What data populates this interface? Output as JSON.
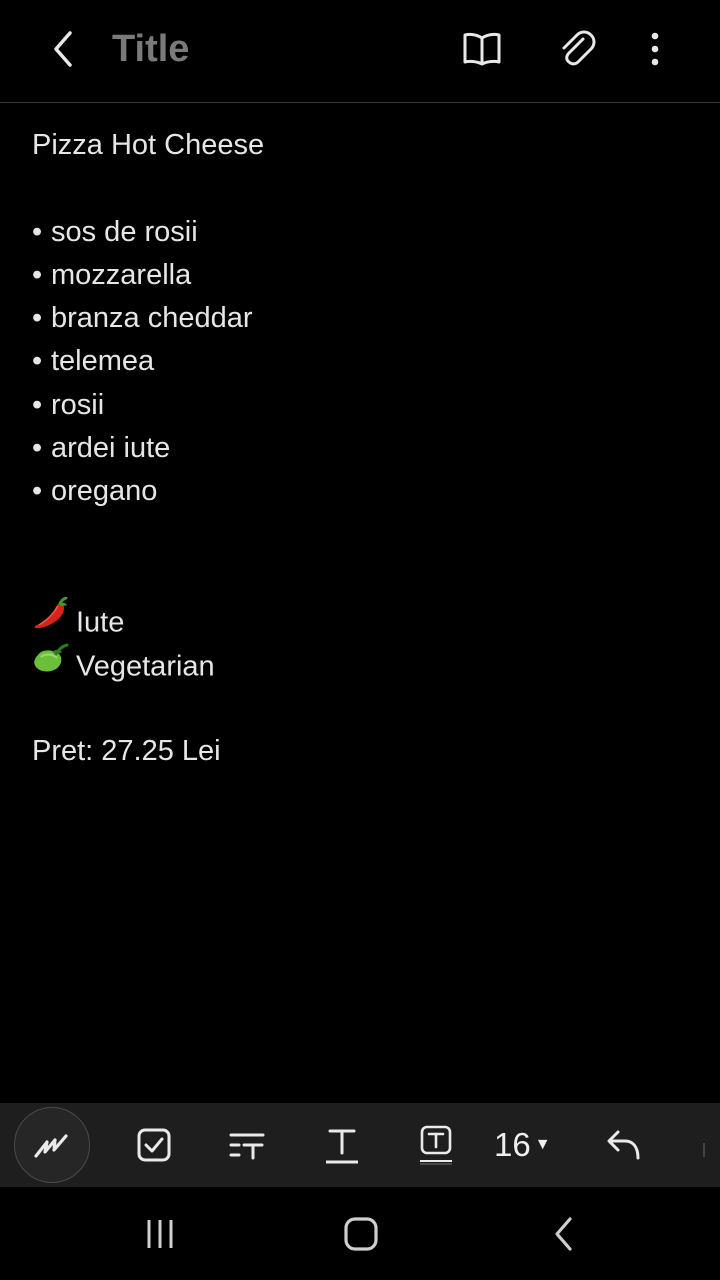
{
  "header": {
    "title": "Title",
    "icons": {
      "back": "back-arrow-icon",
      "reading_mode": "book-icon",
      "attach": "paperclip-icon",
      "more": "more-vertical-icon"
    }
  },
  "note": {
    "heading": "Pizza Hot Cheese",
    "ingredients": [
      "sos de rosii",
      "mozzarella",
      "branza cheddar",
      "telemea",
      "rosii",
      "ardei iute",
      "oregano"
    ],
    "bullet": "•",
    "tags": [
      {
        "icon": "chili-pepper-icon",
        "label": "Iute"
      },
      {
        "icon": "green-pepper-icon",
        "label": "Vegetarian"
      }
    ],
    "price": "Pret: 27.25 Lei"
  },
  "toolbar": {
    "font_size": "16",
    "icons": [
      "pen-icon",
      "checkbox-icon",
      "text-style-icon",
      "text-format-icon",
      "text-box-icon",
      "undo-icon"
    ]
  },
  "navbar": {
    "icons": [
      "recents-icon",
      "home-icon",
      "back-icon"
    ]
  },
  "colors": {
    "background": "#000000",
    "toolbar": "#1e1e1e",
    "text": "#e6e6e6",
    "title_placeholder": "#7a7a7a"
  }
}
